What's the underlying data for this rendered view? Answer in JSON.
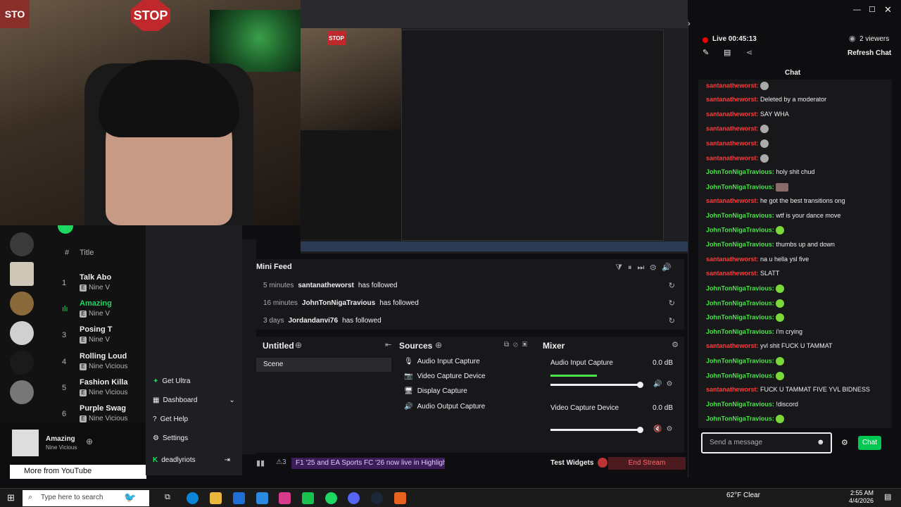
{
  "webcam": {
    "stop_sign": "STOP",
    "corner_sign": "STO"
  },
  "preview": {
    "stop_sign": "STOP"
  },
  "spotify": {
    "header_num": "#",
    "header_title": "Title",
    "tracks": [
      {
        "num": "1",
        "title": "Talk Abo",
        "artist": "Nine V"
      },
      {
        "num": "",
        "title": "Amazing",
        "artist": "Nine V"
      },
      {
        "num": "3",
        "title": "Posing T",
        "artist": "Nine V"
      },
      {
        "num": "4",
        "title": "Rolling Loud",
        "artist": "Nine Vicious"
      },
      {
        "num": "5",
        "title": "Fashion Killa",
        "artist": "Nine Vicious"
      },
      {
        "num": "6",
        "title": "Purple Swag",
        "artist": "Nine Vicious"
      }
    ],
    "now_playing": {
      "title": "Amazing",
      "artist": "Nine Vicious"
    },
    "more_youtube": "More from YouTube"
  },
  "obs_menu": {
    "items": [
      {
        "icon": "✦",
        "label": "Get Ultra"
      },
      {
        "icon": "▦",
        "label": "Dashboard"
      },
      {
        "icon": "?",
        "label": "Get Help"
      },
      {
        "icon": "⚙",
        "label": "Settings"
      }
    ],
    "account": "deadlyriots"
  },
  "minifeed": {
    "title": "Mini Feed",
    "items": [
      {
        "time": "5 minutes",
        "user": "santanatheworst",
        "action": "has followed"
      },
      {
        "time": "16 minutes",
        "user": "JohnTonNigaTravious",
        "action": "has followed"
      },
      {
        "time": "3 days",
        "user": "Jordandanvi76",
        "action": "has followed"
      }
    ]
  },
  "scenes": {
    "title": "Untitled",
    "items": [
      "Scene"
    ]
  },
  "sources": {
    "title": "Sources",
    "items": [
      {
        "icon": "🎙",
        "label": "Audio Input Capture"
      },
      {
        "icon": "📷",
        "label": "Video Capture Device"
      },
      {
        "icon": "🖥",
        "label": "Display Capture"
      },
      {
        "icon": "🔊",
        "label": "Audio Output Capture"
      }
    ]
  },
  "mixer": {
    "title": "Mixer",
    "channels": [
      {
        "label": "Audio Input Capture",
        "db": "0.0 dB"
      },
      {
        "label": "Video Capture Device",
        "db": "0.0 dB"
      }
    ]
  },
  "statusbar": {
    "notifications": "3",
    "promo": "F1 '25 and EA Sports FC '26 now live in Highlighter!",
    "test_widgets": "Test Widgets",
    "end_stream": "End Stream"
  },
  "chat": {
    "live_label": "Live 00:45:13",
    "viewers": "2 viewers",
    "refresh": "Refresh Chat",
    "title": "Chat",
    "messages": [
      {
        "user": "santanatheworst",
        "color": "red",
        "text": "",
        "emote": true
      },
      {
        "user": "santanatheworst",
        "color": "red",
        "text": "Deleted by a moderator",
        "emote": false
      },
      {
        "user": "santanatheworst",
        "color": "red",
        "text": "SAY WHA",
        "emote": false
      },
      {
        "user": "santanatheworst",
        "color": "red",
        "text": "",
        "emote": true
      },
      {
        "user": "santanatheworst",
        "color": "red",
        "text": "",
        "emote": true
      },
      {
        "user": "santanatheworst",
        "color": "red",
        "text": "",
        "emote": true
      },
      {
        "user": "JohnTonNigaTravious",
        "color": "green",
        "text": "holy shit chud",
        "emote": false
      },
      {
        "user": "JohnTonNigaTravious",
        "color": "green",
        "text": "",
        "emote": true
      },
      {
        "user": "santanatheworst",
        "color": "red",
        "text": "he got the best transitions ong",
        "emote": false
      },
      {
        "user": "JohnTonNigaTravious",
        "color": "green",
        "text": "wtf is your dance move",
        "emote": false
      },
      {
        "user": "JohnTonNigaTravious",
        "color": "green",
        "text": "",
        "emote": true
      },
      {
        "user": "JohnTonNigaTravious",
        "color": "green",
        "text": "thumbs up and down",
        "emote": false
      },
      {
        "user": "santanatheworst",
        "color": "red",
        "text": "na u hella ysl five",
        "emote": false
      },
      {
        "user": "santanatheworst",
        "color": "red",
        "text": "SLATT",
        "emote": false
      },
      {
        "user": "JohnTonNigaTravious",
        "color": "green",
        "text": "",
        "emote": true
      },
      {
        "user": "JohnTonNigaTravious",
        "color": "green",
        "text": "",
        "emote": true
      },
      {
        "user": "JohnTonNigaTravious",
        "color": "green",
        "text": "",
        "emote": true
      },
      {
        "user": "JohnTonNigaTravious",
        "color": "green",
        "text": "i'm crying",
        "emote": false
      },
      {
        "user": "santanatheworst",
        "color": "red",
        "text": "yvl shit FUCK U TAMMAT",
        "emote": false
      },
      {
        "user": "JohnTonNigaTravious",
        "color": "green",
        "text": "",
        "emote": true
      },
      {
        "user": "JohnTonNigaTravious",
        "color": "green",
        "text": "",
        "emote": true
      },
      {
        "user": "santanatheworst",
        "color": "red",
        "text": "FUCK U TAMMAT FIVE YVL BIDNESS",
        "emote": false
      },
      {
        "user": "JohnTonNigaTravious",
        "color": "green",
        "text": "!discord",
        "emote": false
      },
      {
        "user": "JohnTonNigaTravious",
        "color": "green",
        "text": "",
        "emote": true
      }
    ],
    "input_placeholder": "Send a message",
    "send_label": "Chat"
  },
  "taskbar": {
    "search_placeholder": "Type here to search",
    "weather": "62°F  Clear",
    "time": "2:55 AM",
    "date": "4/4/2026"
  }
}
